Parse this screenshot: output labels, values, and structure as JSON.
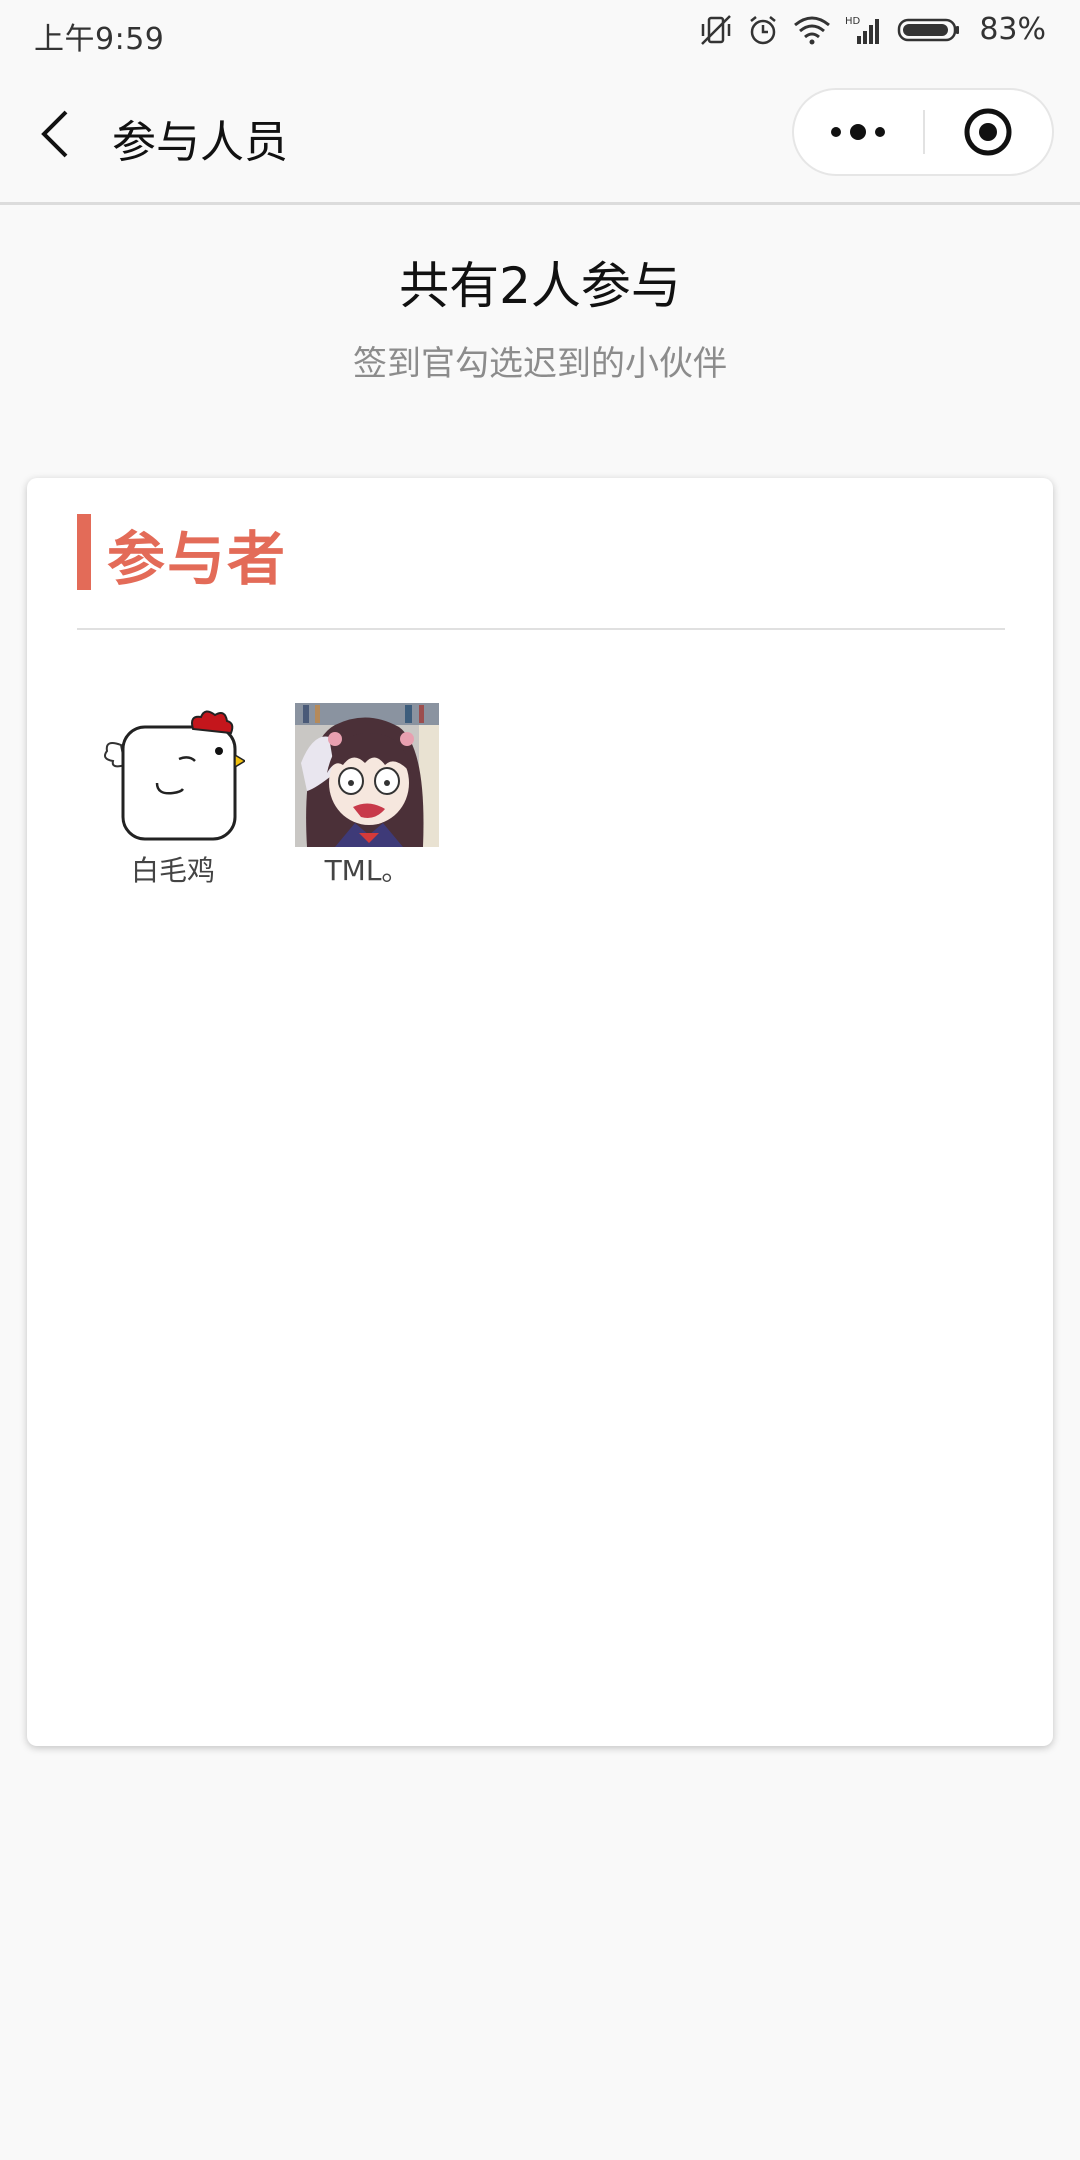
{
  "status_bar": {
    "time": "上午9:59",
    "battery": "83%",
    "icons": [
      "vibrate-off-icon",
      "alarm-icon",
      "wifi-icon",
      "hd-signal-icon",
      "battery-icon"
    ]
  },
  "nav": {
    "title": "参与人员",
    "back_icon": "chevron-left-icon",
    "more_icon": "more-dots-icon",
    "close_icon": "target-close-icon"
  },
  "summary": {
    "title": "共有2人参与",
    "subtitle": "签到官勾选迟到的小伙伴"
  },
  "section": {
    "title": "参与者"
  },
  "participants": [
    {
      "name": "白毛鸡",
      "avatar": "chicken-avatar"
    },
    {
      "name": "TML。",
      "avatar": "anime-girl-avatar"
    }
  ],
  "colors": {
    "accent": "#e36b58",
    "background": "#f9f9f9"
  }
}
